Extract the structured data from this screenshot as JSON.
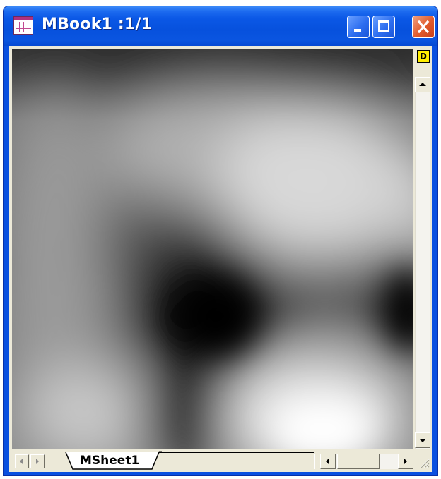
{
  "window": {
    "title": "MBook1 :1/1",
    "icon": "matrix-book-icon"
  },
  "titlebar_buttons": {
    "minimize": "minimize-icon",
    "maximize": "maximize-icon",
    "close": "close-icon"
  },
  "colors": {
    "titlebar": "#0751dd",
    "close_button": "#e05a2c",
    "window_face": "#ece9d8",
    "d_indicator": "#ffee00"
  },
  "image_view": {
    "content": "grayscale matrix image"
  },
  "side_indicator": {
    "label": "D"
  },
  "sheet_tabs": [
    {
      "label": "MSheet1",
      "active": true
    }
  ]
}
